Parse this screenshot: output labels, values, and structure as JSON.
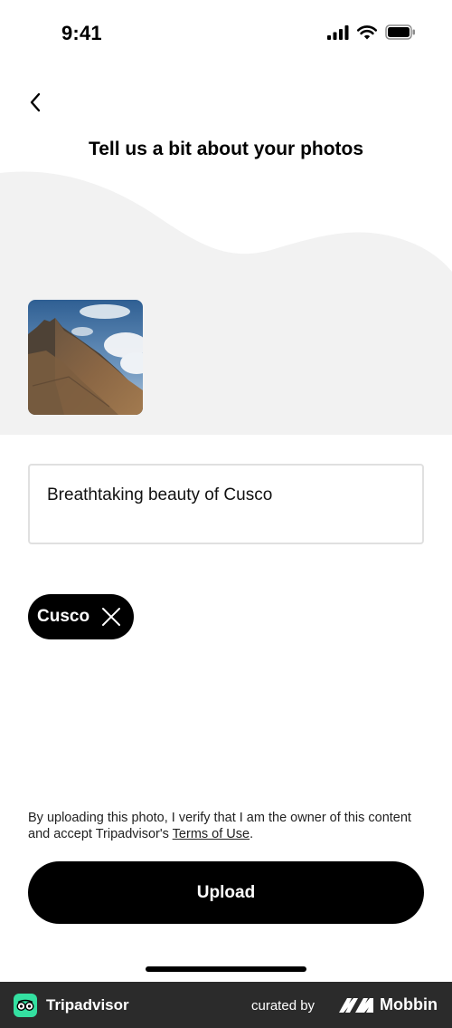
{
  "status_bar": {
    "time": "9:41",
    "icons": [
      "cellular-signal-icon",
      "wifi-icon",
      "battery-icon"
    ]
  },
  "header": {
    "back_icon": "chevron-left-icon",
    "title": "Tell us a bit about your photos"
  },
  "photo": {
    "description": "thumbnail of mountain"
  },
  "caption": {
    "value": "Breathtaking beauty of Cusco"
  },
  "tags": [
    {
      "label": "Cusco",
      "remove_icon": "close-icon"
    }
  ],
  "disclaimer": {
    "text": "By uploading this photo, I verify that I am the owner of this content and accept Tripadvisor's ",
    "link": "Terms of Use",
    "suffix": "."
  },
  "upload_button": {
    "label": "Upload"
  },
  "footer": {
    "brand": "Tripadvisor",
    "curated_by": "curated by",
    "mobbin": "Mobbin"
  },
  "colors": {
    "primary": "#000000",
    "wave_gray": "#f2f2f2",
    "input_border": "#e0e0e0",
    "tripadvisor_green": "#34e0a1",
    "footer_bg": "#2b2b2b"
  }
}
